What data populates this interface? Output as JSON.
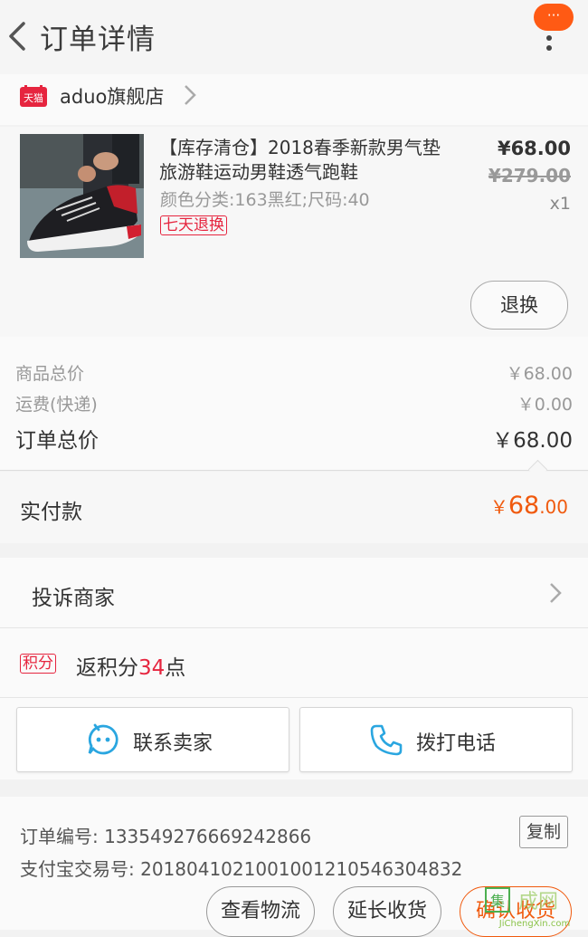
{
  "header": {
    "title": "订单详情",
    "badge": "···"
  },
  "shop": {
    "brand_badge": "天猫",
    "name": "aduo旗舰店"
  },
  "product": {
    "title": "【库存清仓】2018春季新款男气垫旅游鞋运动男鞋透气跑鞋",
    "spec": "颜色分类:163黑红;尺码:40",
    "return_badge": "七天退换",
    "price_now": "¥68.00",
    "price_old": "¥279.00",
    "quantity": "x1",
    "refund_button": "退换"
  },
  "summary": {
    "goods_label": "商品总价",
    "goods_value": "￥68.00",
    "shipping_label": "运费(快递)",
    "shipping_value": "￥0.00",
    "total_label": "订单总价",
    "total_value": "￥68.00",
    "paid_label": "实付款",
    "paid_currency": "￥",
    "paid_int": "68",
    "paid_dec": ".00"
  },
  "complaint": {
    "label": "投诉商家"
  },
  "points": {
    "badge": "积分",
    "prefix": "返积分",
    "number": "34",
    "suffix": "点"
  },
  "actions": {
    "contact_seller": "联系卖家",
    "call_phone": "拨打电话"
  },
  "order_info": {
    "order_no": "订单编号: 133549276669242866",
    "alipay_no": "支付宝交易号: 2018041021001001210546304832",
    "copy_button": "复制"
  },
  "bottom_bar": {
    "logistics": "查看物流",
    "extend": "延长收货",
    "confirm": "确认收货"
  },
  "watermark": {
    "text": "JiChengXin.com"
  },
  "colors": {
    "accent_orange": "#f05a0e",
    "tmall_red": "#e6253f",
    "icon_blue": "#2aa6e0"
  }
}
